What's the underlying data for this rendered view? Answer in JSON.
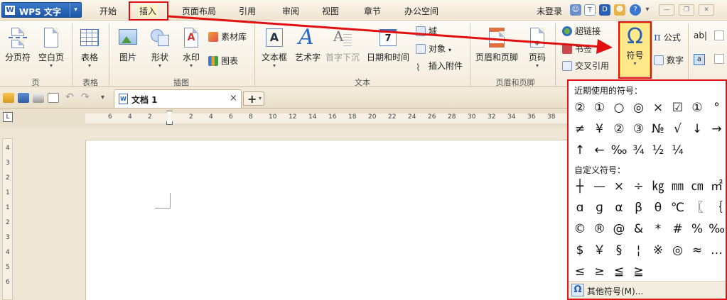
{
  "app": {
    "logo_letter": "W",
    "title": "WPS 文字"
  },
  "menubar": {
    "items": [
      "开始",
      "插入",
      "页面布局",
      "引用",
      "审阅",
      "视图",
      "章节",
      "办公空间"
    ],
    "selected": "插入",
    "login": "未登录"
  },
  "ribbon": {
    "page_break": "分页符",
    "blank_page": "空白页",
    "group_page": "页",
    "table": "表格",
    "group_table": "表格",
    "picture": "图片",
    "shape": "形状",
    "watermark": "水印",
    "material": "素材库",
    "chart": "图表",
    "group_illustration": "插图",
    "textbox": "文本框",
    "wordart": "艺术字",
    "dropcap": "首字下沉",
    "datetime": "日期和时间",
    "field": "域",
    "object": "对象",
    "attachment": "插入附件",
    "group_text": "文本",
    "header_footer": "页眉和页脚",
    "page_number": "页码",
    "group_header_footer": "页眉和页脚",
    "hyperlink": "超链接",
    "bookmark": "书签",
    "crossref": "交叉引用",
    "symbol": "符号",
    "formula": "公式",
    "number": "数字",
    "partial_ab": "ab|"
  },
  "tabs": {
    "document_name": "文档 1",
    "close": "×",
    "new": "+"
  },
  "ruler": {
    "top_ticks": [
      "6",
      "4",
      "2",
      "2",
      "4",
      "6",
      "8",
      "10",
      "12",
      "14",
      "16",
      "18",
      "20",
      "22",
      "24",
      "26",
      "28",
      "30",
      "32",
      "34",
      "36",
      "38"
    ],
    "left_ticks": [
      "4",
      "3",
      "2",
      "1",
      "1",
      "2",
      "3",
      "4",
      "5",
      "6"
    ]
  },
  "symbol_panel": {
    "recent_title": "近期使用的符号：",
    "recent": [
      "②",
      "①",
      "○",
      "◎",
      "×",
      "☑",
      "①",
      "°",
      "≠",
      "¥",
      "②",
      "③",
      "№",
      "√",
      "↓",
      "→",
      "↑",
      "←",
      "‰",
      "¾",
      "½",
      "¼"
    ],
    "custom_title": "自定义符号：",
    "custom": [
      "┼",
      "—",
      "×",
      "÷",
      "㎏",
      "㎜",
      "㎝",
      "㎡",
      "ɑ",
      "ɡ",
      "α",
      "β",
      "θ",
      "℃",
      "〖",
      "｛",
      "©",
      "®",
      "@",
      "&",
      "*",
      "#",
      "%",
      "‰",
      "$",
      "￥",
      "§",
      "¦",
      "※",
      "◎",
      "≈",
      "…",
      "≤",
      "≥",
      "≦",
      "≧"
    ],
    "more": "其他符号(M)..."
  },
  "colors": {
    "annotation": "#e01010",
    "highlight": "#ffe98a",
    "accent": "#1d56a8"
  }
}
